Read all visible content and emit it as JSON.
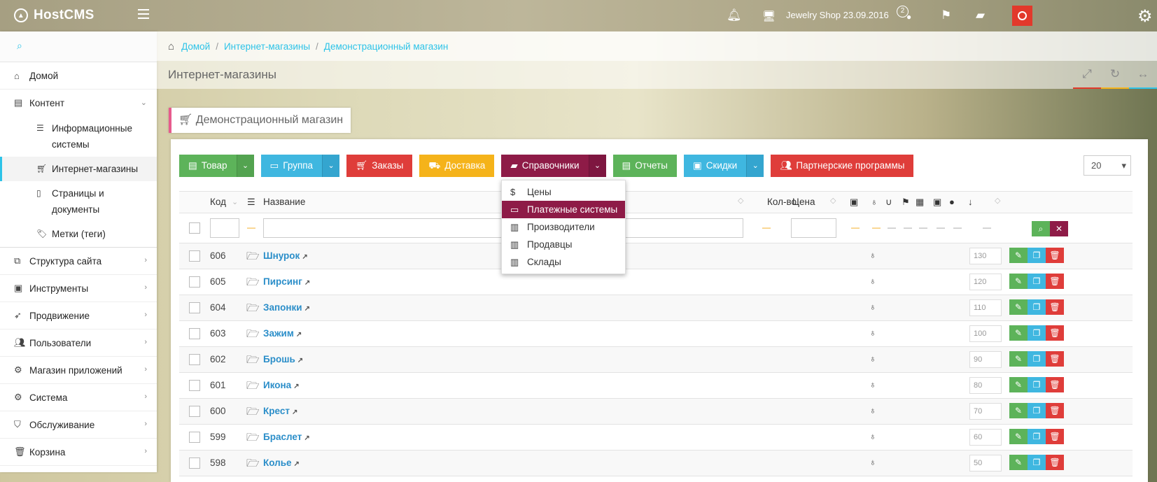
{
  "app": {
    "logo": "HostCMS",
    "logo_icon": "chevron-up-circle-icon"
  },
  "topbar": {
    "shop_name": "Jewelry Shop 23.09.2016",
    "badge_count": "2"
  },
  "sidebar": {
    "items": [
      {
        "label": "Домой",
        "icon": "home-icon"
      },
      {
        "label": "Контент",
        "icon": "newspaper-icon",
        "chevron": "⌄"
      },
      {
        "label": "Структура сайта",
        "icon": "sitemap-icon",
        "chevron": "›"
      },
      {
        "label": "Инструменты",
        "icon": "briefcase-icon",
        "chevron": "›"
      },
      {
        "label": "Продвижение",
        "icon": "rocket-icon",
        "chevron": "›"
      },
      {
        "label": "Пользователи",
        "icon": "users-icon",
        "chevron": "›"
      },
      {
        "label": "Магазин приложений",
        "icon": "gears-icon",
        "chevron": "›"
      },
      {
        "label": "Система",
        "icon": "gear-icon",
        "chevron": "›"
      },
      {
        "label": "Обслуживание",
        "icon": "shield-icon",
        "chevron": "›"
      },
      {
        "label": "Корзина",
        "icon": "trash-icon",
        "chevron": "›"
      }
    ],
    "subitems": [
      {
        "label": "Информационные системы",
        "line1": "Информационные",
        "line2": "системы"
      },
      {
        "label": "Интернет-магазины"
      },
      {
        "label": "Страницы и документы",
        "line1": "Страницы и",
        "line2": "документы"
      },
      {
        "label": "Метки (теги)"
      }
    ]
  },
  "breadcrumb": [
    "Домой",
    "Интернет-магазины",
    "Демонстрационный магазин"
  ],
  "page_title": "Интернет-магазины",
  "section_tab": "Демонстрационный магазин",
  "toolbar": {
    "tovar": "Товар",
    "gruppa": "Группа",
    "zakazy": "Заказы",
    "dostavka": "Доставка",
    "spravochniki": "Справочники",
    "otchety": "Отчеты",
    "skidki": "Скидки",
    "partner": "Партнерские программы",
    "per_page": "20"
  },
  "dropdown": {
    "items": [
      {
        "label": "Цены",
        "icon": "dollar-icon"
      },
      {
        "label": "Платежные системы",
        "icon": "credit-card-icon",
        "active": true
      },
      {
        "label": "Производители",
        "icon": "building-icon"
      },
      {
        "label": "Продавцы",
        "icon": "building-icon"
      },
      {
        "label": "Склады",
        "icon": "building-icon"
      }
    ]
  },
  "table": {
    "headers": {
      "code": "Код",
      "name": "Название",
      "qty": "Кол-во",
      "price": "Цена"
    },
    "rows": [
      {
        "code": "606",
        "name": "Шнурок",
        "sort": "130"
      },
      {
        "code": "605",
        "name": "Пирсинг",
        "sort": "120"
      },
      {
        "code": "604",
        "name": "Запонки",
        "sort": "110"
      },
      {
        "code": "603",
        "name": "Зажим",
        "sort": "100"
      },
      {
        "code": "602",
        "name": "Брошь",
        "sort": "90"
      },
      {
        "code": "601",
        "name": "Икона",
        "sort": "80"
      },
      {
        "code": "600",
        "name": "Крест",
        "sort": "70"
      },
      {
        "code": "599",
        "name": "Браслет",
        "sort": "60"
      },
      {
        "code": "598",
        "name": "Колье",
        "sort": "50"
      }
    ]
  },
  "colors": {
    "accent": "#2dc3e8",
    "green": "#5db35a",
    "blue": "#3fb7e0",
    "red": "#df3d3a",
    "orange": "#f5b31a",
    "purple": "#8e1b47",
    "link": "#2b8ec9",
    "power": "#e2392b"
  }
}
